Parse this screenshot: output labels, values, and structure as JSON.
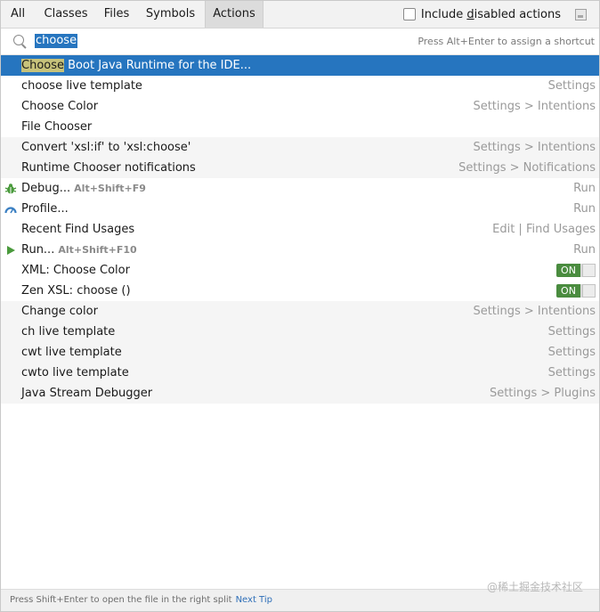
{
  "tabs": [
    {
      "label": "All",
      "active": false
    },
    {
      "label": "Classes",
      "active": false
    },
    {
      "label": "Files",
      "active": false
    },
    {
      "label": "Symbols",
      "active": false
    },
    {
      "label": "Actions",
      "active": true
    }
  ],
  "include_disabled": {
    "label_pre": "Include ",
    "label_mnemonic": "d",
    "label_post": "isabled actions",
    "checked": false
  },
  "search": {
    "query": "choose",
    "hint": "Press Alt+Enter to assign a shortcut"
  },
  "results": [
    {
      "highlight": "Choose",
      "label": " Boot Java Runtime for the IDE...",
      "meta": "",
      "selected": true
    },
    {
      "label": "choose live template",
      "meta": "Settings"
    },
    {
      "label": "Choose Color",
      "meta": "Settings > Intentions"
    },
    {
      "label": "File Chooser",
      "meta": ""
    },
    {
      "label": "Convert 'xsl:if' to 'xsl:choose'",
      "meta": "Settings > Intentions"
    },
    {
      "label": "Runtime Chooser notifications",
      "meta": "Settings > Notifications"
    },
    {
      "label": "Debug...",
      "shortcut": "Alt+Shift+F9",
      "meta": "Run",
      "icon": "debug-bug-icon"
    },
    {
      "label": "Profile...",
      "meta": "Run",
      "icon": "profiler-gauge-icon"
    },
    {
      "label": "Recent Find Usages",
      "meta": "Edit | Find Usages"
    },
    {
      "label": "Run...",
      "shortcut": "Alt+Shift+F10",
      "meta": "Run",
      "icon": "run-play-icon"
    },
    {
      "label": "XML: Choose Color",
      "toggle": "ON"
    },
    {
      "label": "Zen XSL: choose ()",
      "toggle": "ON"
    },
    {
      "label": "Change color",
      "meta": "Settings > Intentions"
    },
    {
      "label": "ch live template",
      "meta": "Settings"
    },
    {
      "label": "cwt live template",
      "meta": "Settings"
    },
    {
      "label": "cwto live template",
      "meta": "Settings"
    },
    {
      "label": "Java Stream Debugger",
      "meta": "Settings > Plugins"
    }
  ],
  "footer": {
    "tip": "Press Shift+Enter to open the file in the right split",
    "next_tip": "Next Tip",
    "watermark": "@稀土掘金技术社区"
  },
  "colors": {
    "selection": "#2675bf",
    "highlight": "#c7c27a",
    "toggle_on": "#4a8c3f",
    "run_green": "#4a9a3c",
    "profile_blue": "#3a7fc2"
  }
}
